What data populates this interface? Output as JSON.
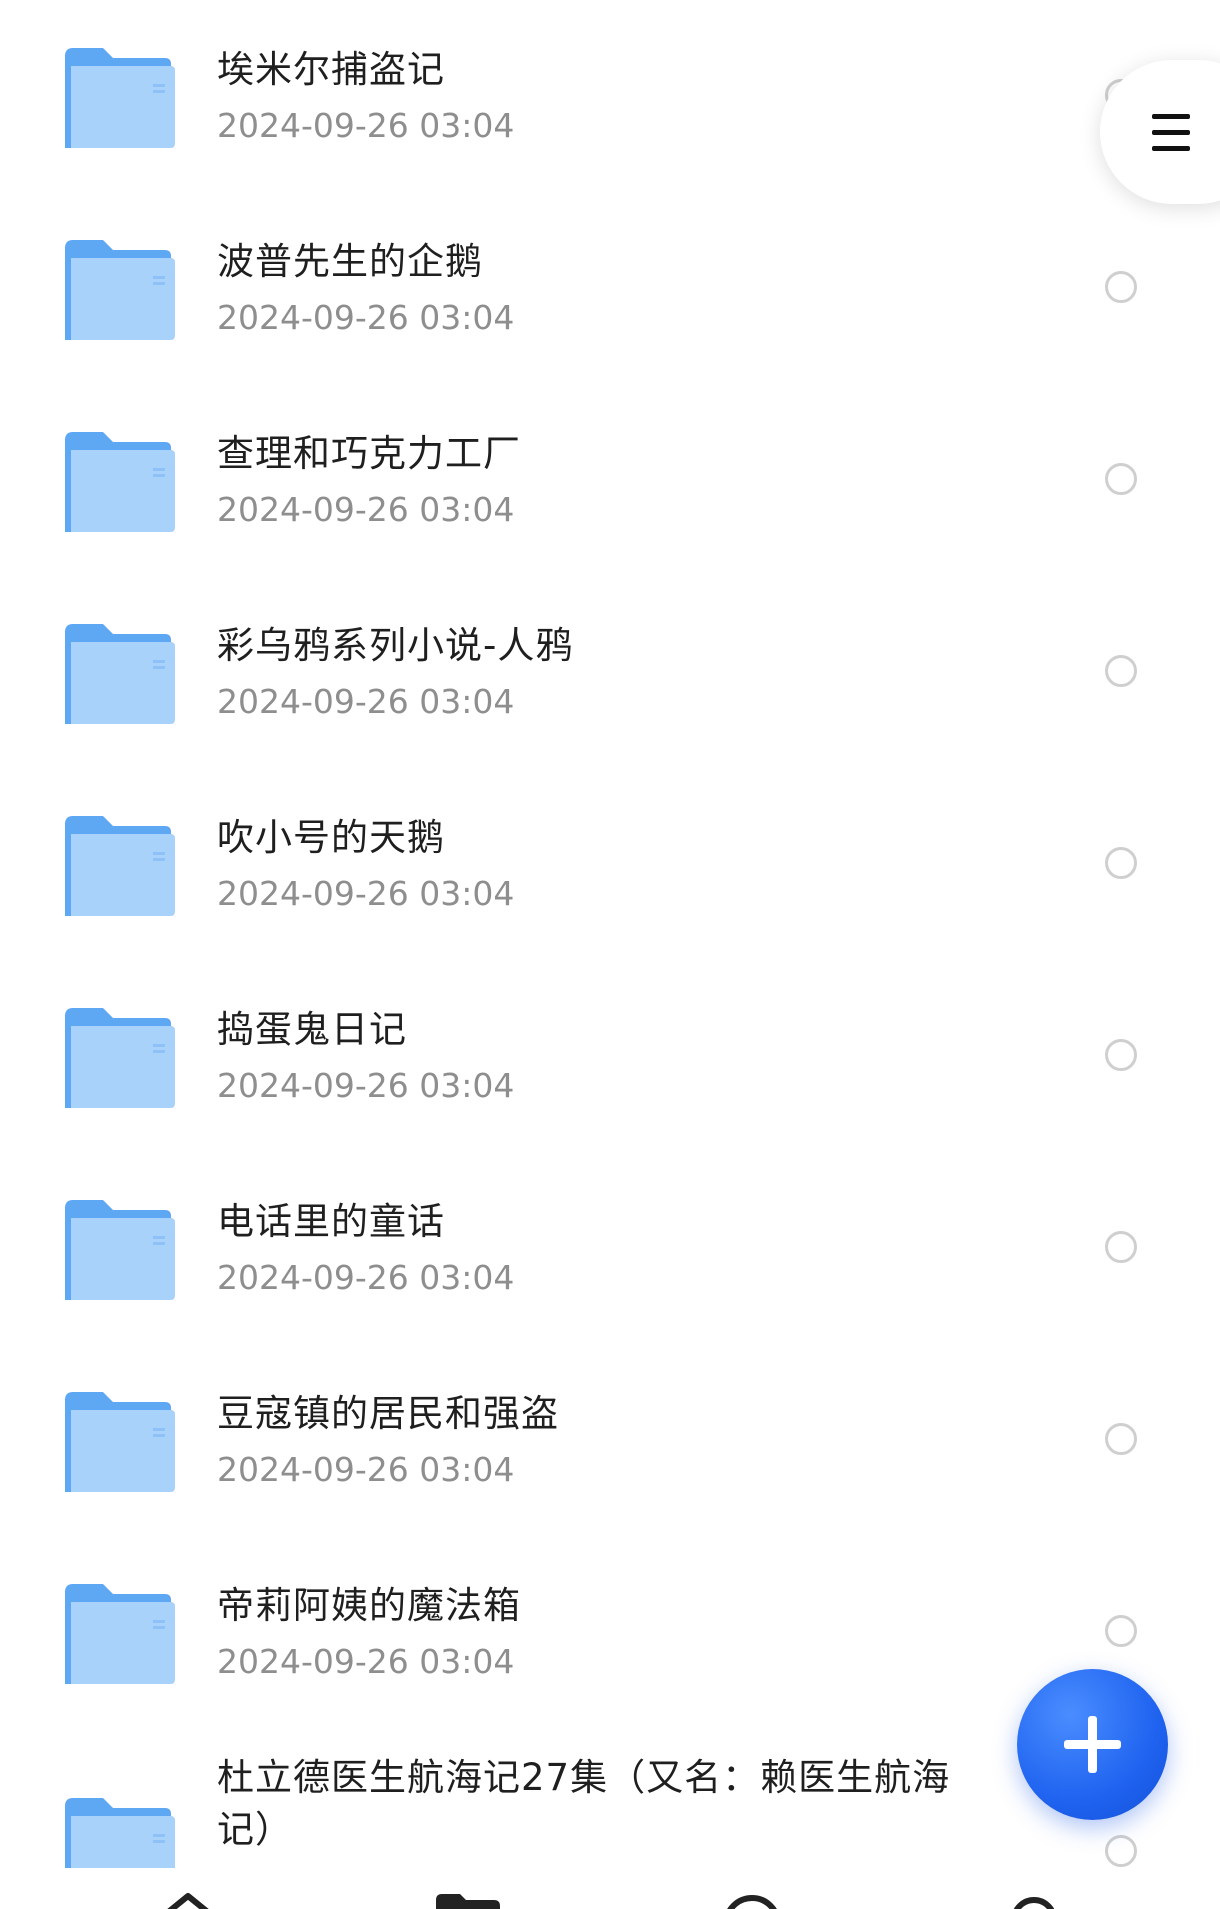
{
  "files": [
    {
      "name": "埃米尔捕盗记",
      "date": "2024-09-26 03:04"
    },
    {
      "name": "波普先生的企鹅",
      "date": "2024-09-26 03:04"
    },
    {
      "name": "查理和巧克力工厂",
      "date": "2024-09-26 03:04"
    },
    {
      "name": "彩乌鸦系列小说-人鸦",
      "date": "2024-09-26 03:04"
    },
    {
      "name": "吹小号的天鹅",
      "date": "2024-09-26 03:04"
    },
    {
      "name": "捣蛋鬼日记",
      "date": "2024-09-26 03:04"
    },
    {
      "name": "电话里的童话",
      "date": "2024-09-26 03:04"
    },
    {
      "name": "豆寇镇的居民和强盗",
      "date": "2024-09-26 03:04"
    },
    {
      "name": "帝莉阿姨的魔法箱",
      "date": "2024-09-26 03:04"
    },
    {
      "name": "杜立德医生航海记27集（又名：赖医生航海记）",
      "date": ""
    }
  ],
  "icons": {
    "folder": "folder-icon",
    "menu": "menu-icon",
    "add": "plus-icon",
    "checkbox": "radio-circle-icon",
    "nav": [
      "home-icon",
      "folder-icon",
      "search-icon",
      "profile-icon"
    ]
  },
  "colors": {
    "folder_light": "#a9d2fb",
    "folder_dark": "#5ea7f2",
    "fab": "#1f63f0",
    "text_primary": "#1f1f1f",
    "text_secondary": "#8e8e8e"
  }
}
